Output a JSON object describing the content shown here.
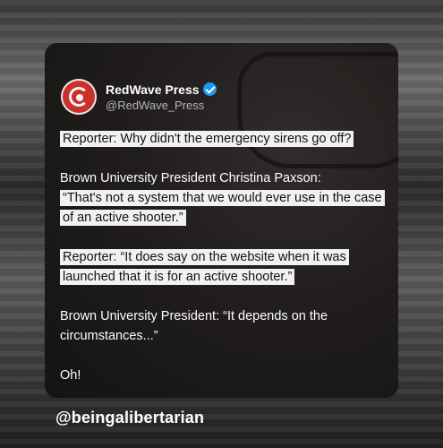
{
  "post": {
    "display_name": "RedWave Press",
    "handle": "@RedWave_Press",
    "verified_icon": "verified-badge-icon",
    "lines": {
      "q1": "Reporter: Why didn't the emergency sirens go off?",
      "a1_intro": "Brown University President Christina Paxson:",
      "a1_quote": "“That's not a system that we would ever use in the case of an active shooter.”",
      "q2": "Reporter: “It does say on the website when it was launched that it is for an active shooter.”",
      "a2": "Brown University President: “It depends on the circumstances...”",
      "end": "Oh!"
    }
  },
  "credit": "@beingalibertarian",
  "colors": {
    "verified": "#1d9bf0",
    "avatar": "#c8312c",
    "highlight": "#f1f1f1"
  }
}
